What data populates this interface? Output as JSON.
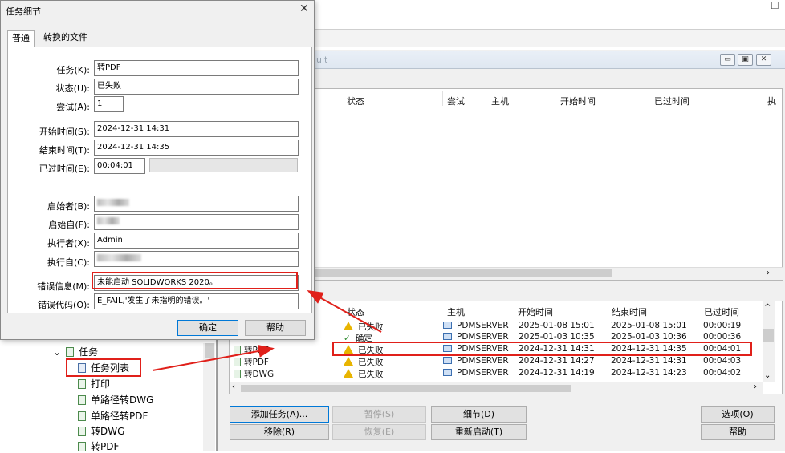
{
  "window_controls": {
    "minimize": "—",
    "maximize": "☐"
  },
  "main_window": {
    "mdi_title_partial": "ult",
    "upper_headers": [
      "状态",
      "尝试",
      "主机",
      "开始时间",
      "已过时间",
      "执"
    ],
    "lower_headers": [
      "状态",
      "主机",
      "开始时间",
      "结束时间",
      "已过时间"
    ],
    "rows": [
      {
        "name": "",
        "status": "已失败",
        "status_icon": "warning-icon",
        "host": "PDMSERVER",
        "start": "2025-01-08 15:01",
        "end": "2025-01-08 15:01",
        "elapsed": "00:00:19"
      },
      {
        "name": "",
        "status": "确定",
        "status_icon": "check-icon",
        "host": "PDMSERVER",
        "start": "2025-01-03 10:35",
        "end": "2025-01-03 10:36",
        "elapsed": "00:00:36"
      },
      {
        "name": "转PDF",
        "status": "已失败",
        "status_icon": "warning-icon",
        "host": "PDMSERVER",
        "start": "2024-12-31 14:31",
        "end": "2024-12-31 14:35",
        "elapsed": "00:04:01"
      },
      {
        "name": "转PDF",
        "status": "已失败",
        "status_icon": "warning-icon",
        "host": "PDMSERVER",
        "start": "2024-12-31 14:27",
        "end": "2024-12-31 14:31",
        "elapsed": "00:04:03"
      },
      {
        "name": "转DWG",
        "status": "已失败",
        "status_icon": "warning-icon",
        "host": "PDMSERVER",
        "start": "2024-12-31 14:19",
        "end": "2024-12-31 14:23",
        "elapsed": "00:04:02"
      }
    ],
    "buttons": {
      "add_task": "添加任务(A)...",
      "pause": "暂停(S)",
      "details": "细节(D)",
      "options": "选项(O)",
      "remove": "移除(R)",
      "resume": "恢复(E)",
      "restart": "重新启动(T)",
      "help": "帮助"
    }
  },
  "tree": {
    "items": [
      {
        "label": "任务",
        "level": 0,
        "expanded": true
      },
      {
        "label": "任务列表",
        "level": 1
      },
      {
        "label": "打印",
        "level": 1
      },
      {
        "label": "单路径转DWG",
        "level": 1
      },
      {
        "label": "单路径转PDF",
        "level": 1
      },
      {
        "label": "转DWG",
        "level": 1
      },
      {
        "label": "转PDF",
        "level": 1
      }
    ]
  },
  "dialog": {
    "title": "任务细节",
    "close": "✕",
    "tabs": [
      "普通",
      "转换的文件"
    ],
    "labels": {
      "task": "任务(K):",
      "state": "状态(U):",
      "attempts": "尝试(A):",
      "start_time": "开始时间(S):",
      "end_time": "结束时间(T):",
      "elapsed": "已过时间(E):",
      "initiated_by": "启始者(B):",
      "initiated_from": "启始自(F):",
      "executed_by": "执行者(X):",
      "executed_from": "执行自(C):",
      "error_info": "错误信息(M):",
      "error_code": "错误代码(O):"
    },
    "values": {
      "task": "转PDF",
      "state": "已失败",
      "attempts": "1",
      "start_time": "2024-12-31 14:31",
      "end_time": "2024-12-31 14:35",
      "elapsed": "00:04:01",
      "executed_by": "Admin",
      "error_info": "未能启动 SOLIDWORKS 2020。",
      "error_code": "E_FAIL,'发生了未指明的错误。'"
    },
    "buttons": {
      "ok": "确定",
      "help": "帮助"
    }
  },
  "colors": {
    "highlight": "#e0201a",
    "warning": "#e8b400",
    "ok": "#2e8b2e"
  }
}
